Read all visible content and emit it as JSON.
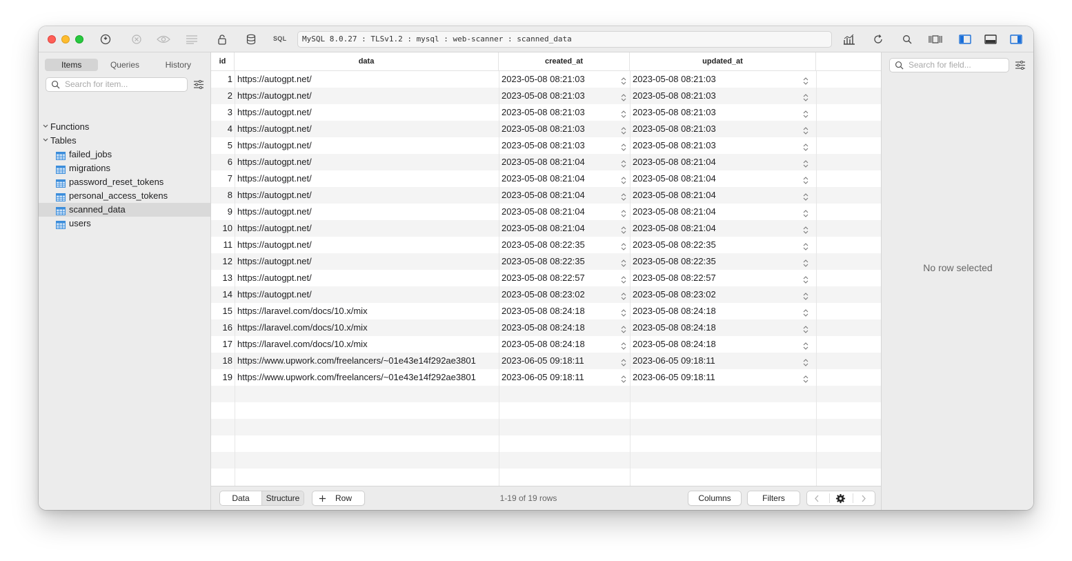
{
  "toolbar": {
    "sql_label": "SQL",
    "connection": "MySQL 8.0.27 : TLSv1.2 : mysql : web-scanner : scanned_data"
  },
  "sidebar": {
    "tabs": [
      "Items",
      "Queries",
      "History"
    ],
    "active_tab": "Items",
    "search_placeholder": "Search for item...",
    "groups": [
      {
        "label": "Functions",
        "expanded": false
      },
      {
        "label": "Tables",
        "expanded": true
      }
    ],
    "tables": [
      "failed_jobs",
      "migrations",
      "password_reset_tokens",
      "personal_access_tokens",
      "scanned_data",
      "users"
    ],
    "selected_table": "scanned_data"
  },
  "table": {
    "columns": [
      "id",
      "data",
      "created_at",
      "updated_at"
    ],
    "rows": [
      [
        "1",
        "https://autogpt.net/",
        "2023-05-08 08:21:03",
        "2023-05-08 08:21:03"
      ],
      [
        "2",
        "https://autogpt.net/",
        "2023-05-08 08:21:03",
        "2023-05-08 08:21:03"
      ],
      [
        "3",
        "https://autogpt.net/",
        "2023-05-08 08:21:03",
        "2023-05-08 08:21:03"
      ],
      [
        "4",
        "https://autogpt.net/",
        "2023-05-08 08:21:03",
        "2023-05-08 08:21:03"
      ],
      [
        "5",
        "https://autogpt.net/",
        "2023-05-08 08:21:03",
        "2023-05-08 08:21:03"
      ],
      [
        "6",
        "https://autogpt.net/",
        "2023-05-08 08:21:04",
        "2023-05-08 08:21:04"
      ],
      [
        "7",
        "https://autogpt.net/",
        "2023-05-08 08:21:04",
        "2023-05-08 08:21:04"
      ],
      [
        "8",
        "https://autogpt.net/",
        "2023-05-08 08:21:04",
        "2023-05-08 08:21:04"
      ],
      [
        "9",
        "https://autogpt.net/",
        "2023-05-08 08:21:04",
        "2023-05-08 08:21:04"
      ],
      [
        "10",
        "https://autogpt.net/",
        "2023-05-08 08:21:04",
        "2023-05-08 08:21:04"
      ],
      [
        "11",
        "https://autogpt.net/",
        "2023-05-08 08:22:35",
        "2023-05-08 08:22:35"
      ],
      [
        "12",
        "https://autogpt.net/",
        "2023-05-08 08:22:35",
        "2023-05-08 08:22:35"
      ],
      [
        "13",
        "https://autogpt.net/",
        "2023-05-08 08:22:57",
        "2023-05-08 08:22:57"
      ],
      [
        "14",
        "https://autogpt.net/",
        "2023-05-08 08:23:02",
        "2023-05-08 08:23:02"
      ],
      [
        "15",
        "https://laravel.com/docs/10.x/mix",
        "2023-05-08 08:24:18",
        "2023-05-08 08:24:18"
      ],
      [
        "16",
        "https://laravel.com/docs/10.x/mix",
        "2023-05-08 08:24:18",
        "2023-05-08 08:24:18"
      ],
      [
        "17",
        "https://laravel.com/docs/10.x/mix",
        "2023-05-08 08:24:18",
        "2023-05-08 08:24:18"
      ],
      [
        "18",
        "https://www.upwork.com/freelancers/~01e43e14f292ae3801",
        "2023-06-05 09:18:11",
        "2023-06-05 09:18:11"
      ],
      [
        "19",
        "https://www.upwork.com/freelancers/~01e43e14f292ae3801",
        "2023-06-05 09:18:11",
        "2023-06-05 09:18:11"
      ]
    ]
  },
  "bottom": {
    "data_tab": "Data",
    "structure_tab": "Structure",
    "add_row": "Row",
    "row_count": "1-19 of 19 rows",
    "columns_button": "Columns",
    "filters_button": "Filters"
  },
  "right_panel": {
    "search_placeholder": "Search for field...",
    "empty_message": "No row selected"
  },
  "colors": {
    "toolbar_bg": "#ececec",
    "row_alt": "#f4f4f4",
    "selected_row": "#d9d9d9",
    "accent_blue": "#1a6ed8",
    "table_icon": "#3b8ddb"
  }
}
